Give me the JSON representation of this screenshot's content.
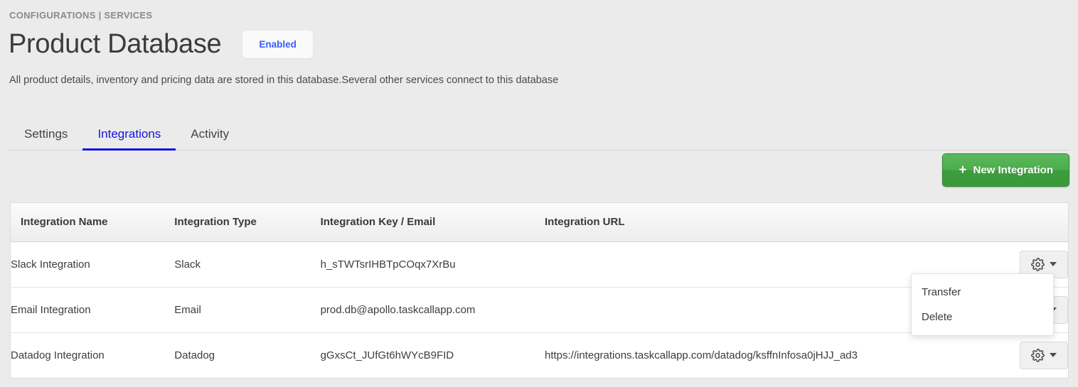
{
  "breadcrumb": "CONFIGURATIONS | SERVICES",
  "header": {
    "title": "Product Database",
    "status_badge": "Enabled",
    "description": "All product details, inventory and pricing data are stored in this database.Several other services connect to this database",
    "badge_color": "#3b5bfd"
  },
  "tabs": [
    {
      "label": "Settings",
      "active": false
    },
    {
      "label": "Integrations",
      "active": true
    },
    {
      "label": "Activity",
      "active": false
    }
  ],
  "toolbar": {
    "new_integration_label": "New Integration",
    "plus_glyph": "+",
    "button_color": "#4cae4c"
  },
  "table": {
    "columns": [
      "Integration Name",
      "Integration Type",
      "Integration Key / Email",
      "Integration URL"
    ],
    "rows": [
      {
        "name": "Slack Integration",
        "type": "Slack",
        "key": "h_sTWTsrIHBTpCOqx7XrBu",
        "url": ""
      },
      {
        "name": "Email Integration",
        "type": "Email",
        "key": "prod.db@apollo.taskcallapp.com",
        "url": ""
      },
      {
        "name": "Datadog Integration",
        "type": "Datadog",
        "key": "gGxsCt_JUfGt6hWYcB9FID",
        "url": "https://integrations.taskcallapp.com/datadog/ksffnInfosa0jHJJ_ad3"
      }
    ]
  },
  "dropdown": {
    "items": [
      {
        "label": "Transfer"
      },
      {
        "label": "Delete"
      }
    ]
  }
}
